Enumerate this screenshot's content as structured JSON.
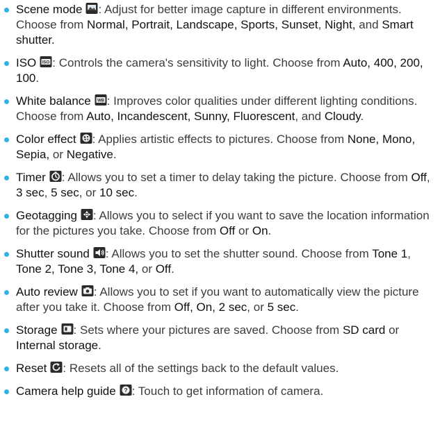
{
  "items": [
    {
      "term": "Scene mode",
      "icon": "scene-mode-icon",
      "segments": [
        {
          "t": ": Adjust for better image capture in different environments. Choose from ",
          "b": false
        },
        {
          "t": "Normal, Portrait, Landscape, Sports, Sunset",
          "b": true
        },
        {
          "t": ", ",
          "b": false
        },
        {
          "t": "Night,",
          "b": true
        },
        {
          "t": " and ",
          "b": false
        },
        {
          "t": "Smart shutter.",
          "b": true
        }
      ]
    },
    {
      "term": "ISO",
      "icon": "iso-icon",
      "segments": [
        {
          "t": ": Controls the camera's sensitivity to light. Choose from ",
          "b": false
        },
        {
          "t": "Auto, 400, 200, 100",
          "b": true
        },
        {
          "t": ".",
          "b": false
        }
      ]
    },
    {
      "term": "White balance",
      "icon": "white-balance-icon",
      "segments": [
        {
          "t": ": Improves color qualities under different lighting conditions. Choose from ",
          "b": false
        },
        {
          "t": "Auto, Incandescent, Sunny, Fluorescent",
          "b": true
        },
        {
          "t": ", and ",
          "b": false
        },
        {
          "t": "Cloudy",
          "b": true
        },
        {
          "t": ".",
          "b": false
        }
      ]
    },
    {
      "term": "Color effect",
      "icon": "color-effect-icon",
      "segments": [
        {
          "t": ": Applies artistic effects to pictures. Choose from ",
          "b": false
        },
        {
          "t": "None, Mono, Sepia,",
          "b": true
        },
        {
          "t": " or ",
          "b": false
        },
        {
          "t": "Negative",
          "b": true
        },
        {
          "t": ".",
          "b": false
        }
      ]
    },
    {
      "term": "Timer",
      "icon": "timer-icon",
      "segments": [
        {
          "t": ": Allows you to set a timer to delay taking the picture. Choose from ",
          "b": false
        },
        {
          "t": "Off",
          "b": true
        },
        {
          "t": ", ",
          "b": false
        },
        {
          "t": "3 sec",
          "b": true
        },
        {
          "t": ", ",
          "b": false
        },
        {
          "t": "5 sec",
          "b": true
        },
        {
          "t": ", or ",
          "b": false
        },
        {
          "t": "10 sec",
          "b": true
        },
        {
          "t": ".",
          "b": false
        }
      ]
    },
    {
      "term": "Geotagging",
      "icon": "geotagging-icon",
      "segments": [
        {
          "t": ": Allows you to select if you want to save the location information for the pictures you take. Choose from ",
          "b": false
        },
        {
          "t": "Off",
          "b": true
        },
        {
          "t": " or ",
          "b": false
        },
        {
          "t": "On",
          "b": true
        },
        {
          "t": ".",
          "b": false
        }
      ]
    },
    {
      "term": "Shutter sound",
      "icon": "shutter-sound-icon",
      "segments": [
        {
          "t": ": Allows you to set the shutter sound. Choose from ",
          "b": false
        },
        {
          "t": "Tone 1",
          "b": true
        },
        {
          "t": ", ",
          "b": false
        },
        {
          "t": "Tone 2, Tone 3, Tone 4,",
          "b": true
        },
        {
          "t": " or ",
          "b": false
        },
        {
          "t": "Off",
          "b": true
        },
        {
          "t": ".",
          "b": false
        }
      ]
    },
    {
      "term": "Auto review",
      "icon": "auto-review-icon",
      "segments": [
        {
          "t": ": Allows you to set if you want to automatically view the picture after you take it. Choose from ",
          "b": false
        },
        {
          "t": "Off, On, 2 sec",
          "b": true
        },
        {
          "t": ", or ",
          "b": false
        },
        {
          "t": "5 sec",
          "b": true
        },
        {
          "t": ".",
          "b": false
        }
      ]
    },
    {
      "term": "Storage",
      "icon": "storage-icon",
      "segments": [
        {
          "t": ": Sets where your pictures are saved. Choose from ",
          "b": false
        },
        {
          "t": "SD card",
          "b": true
        },
        {
          "t": " or ",
          "b": false
        },
        {
          "t": "Internal storage",
          "b": true
        },
        {
          "t": ".",
          "b": false
        }
      ]
    },
    {
      "term": "Reset",
      "icon": "reset-icon",
      "segments": [
        {
          "t": ": Resets all of the settings back to the default values.",
          "b": false
        }
      ]
    },
    {
      "term": "Camera help guide",
      "icon": "help-icon",
      "segments": [
        {
          "t": ": Touch to get information of camera.",
          "b": false
        }
      ]
    }
  ]
}
